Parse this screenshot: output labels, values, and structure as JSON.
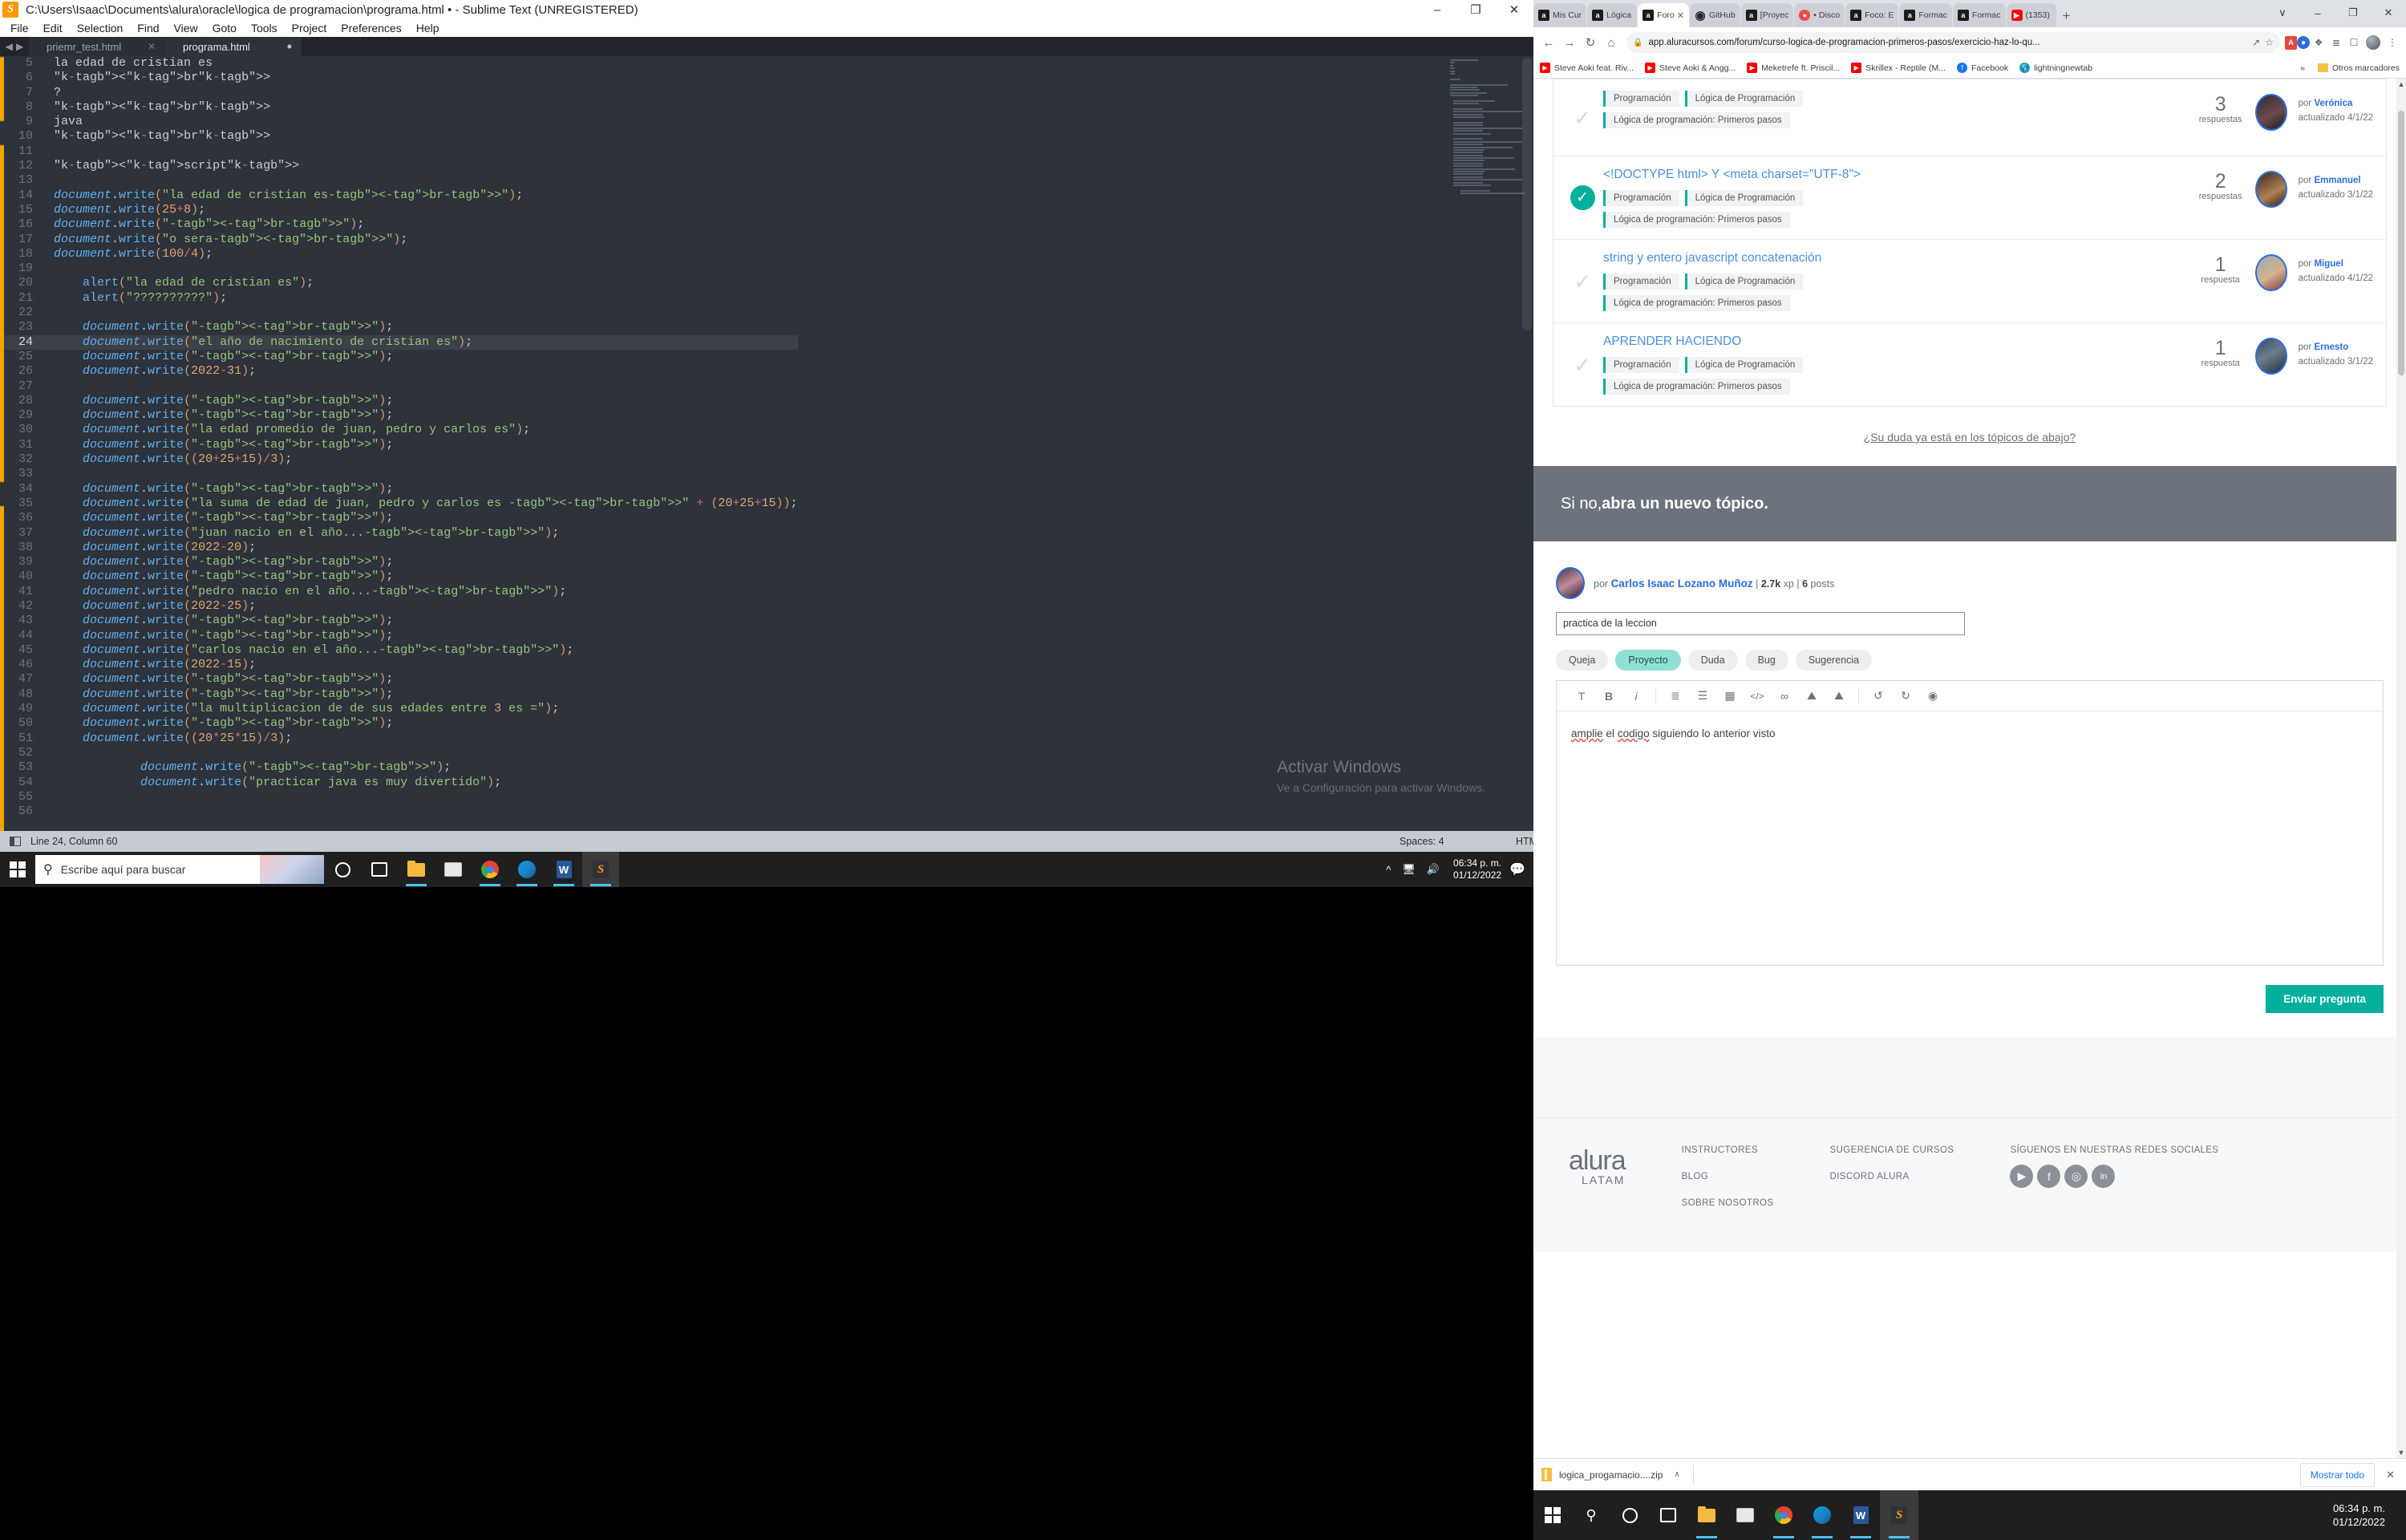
{
  "sublime": {
    "title": "C:\\Users\\Isaac\\Documents\\alura\\oracle\\logica de programacion\\programa.html • - Sublime Text (UNREGISTERED)",
    "menu": [
      "File",
      "Edit",
      "Selection",
      "Find",
      "View",
      "Goto",
      "Tools",
      "Project",
      "Preferences",
      "Help"
    ],
    "tabs": [
      {
        "label": "priemr_test.html",
        "active": false
      },
      {
        "label": "programa.html",
        "active": true
      }
    ],
    "window_buttons": {
      "minimize": "–",
      "maximize": "❐",
      "close": "✕"
    },
    "code_lines": [
      {
        "n": "5",
        "text": "la edad de cristian es"
      },
      {
        "n": "6",
        "text": "<br>"
      },
      {
        "n": "7",
        "text": "?"
      },
      {
        "n": "8",
        "text": "<br>"
      },
      {
        "n": "9",
        "text": "java"
      },
      {
        "n": "10",
        "text": "<br>"
      },
      {
        "n": "11",
        "text": ""
      },
      {
        "n": "12",
        "text": "<script>"
      },
      {
        "n": "13",
        "text": ""
      },
      {
        "n": "14",
        "text": "document.write(\"la edad de cristian es<br>\");"
      },
      {
        "n": "15",
        "text": "document.write(25+8);"
      },
      {
        "n": "16",
        "text": "document.write(\"<br>\");"
      },
      {
        "n": "17",
        "text": "document.write(\"o sera<br>\");"
      },
      {
        "n": "18",
        "text": "document.write(100/4);"
      },
      {
        "n": "19",
        "text": ""
      },
      {
        "n": "20",
        "text": "    alert(\"la edad de cristian es\");"
      },
      {
        "n": "21",
        "text": "    alert(\"??????????\");"
      },
      {
        "n": "22",
        "text": ""
      },
      {
        "n": "23",
        "text": "    document.write(\"<br>\");"
      },
      {
        "n": "24",
        "text": "    document.write(\"el año de nacimiento de cristian es\");"
      },
      {
        "n": "25",
        "text": "    document.write(\"<br>\");"
      },
      {
        "n": "26",
        "text": "    document.write(2022-31);"
      },
      {
        "n": "27",
        "text": ""
      },
      {
        "n": "28",
        "text": "    document.write(\"<br>\");"
      },
      {
        "n": "29",
        "text": "    document.write(\"<br>\");"
      },
      {
        "n": "30",
        "text": "    document.write(\"la edad promedio de juan, pedro y carlos es\");"
      },
      {
        "n": "31",
        "text": "    document.write(\"<br>\");"
      },
      {
        "n": "32",
        "text": "    document.write((20+25+15)/3);"
      },
      {
        "n": "33",
        "text": ""
      },
      {
        "n": "34",
        "text": "    document.write(\"<br>\");"
      },
      {
        "n": "35",
        "text": "    document.write(\"la suma de edad de juan, pedro y carlos es <br>\" + (20+25+15));"
      },
      {
        "n": "36",
        "text": "    document.write(\"<br>\");"
      },
      {
        "n": "37",
        "text": "    document.write(\"juan nacio en el año...<br>\");"
      },
      {
        "n": "38",
        "text": "    document.write(2022-20);"
      },
      {
        "n": "39",
        "text": "    document.write(\"<br>\");"
      },
      {
        "n": "40",
        "text": "    document.write(\"<br>\");"
      },
      {
        "n": "41",
        "text": "    document.write(\"pedro nacio en el año...<br>\");"
      },
      {
        "n": "42",
        "text": "    document.write(2022-25);"
      },
      {
        "n": "43",
        "text": "    document.write(\"<br>\");"
      },
      {
        "n": "44",
        "text": "    document.write(\"<br>\");"
      },
      {
        "n": "45",
        "text": "    document.write(\"carlos nacio en el año...<br>\");"
      },
      {
        "n": "46",
        "text": "    document.write(2022-15);"
      },
      {
        "n": "47",
        "text": "    document.write(\"<br>\");"
      },
      {
        "n": "48",
        "text": "    document.write(\"<br>\");"
      },
      {
        "n": "49",
        "text": "    document.write(\"la multiplicacion de de sus edades entre 3 es =\");"
      },
      {
        "n": "50",
        "text": "    document.write(\"<br>\");"
      },
      {
        "n": "51",
        "text": "    document.write((20*25*15)/3);"
      },
      {
        "n": "52",
        "text": ""
      },
      {
        "n": "53",
        "text": "            document.write(\"<br>\");"
      },
      {
        "n": "54",
        "text": "            document.write(\"practicar java es muy divertido\");"
      },
      {
        "n": "55",
        "text": ""
      },
      {
        "n": "56",
        "text": ""
      }
    ],
    "highlight_line": "24",
    "status": {
      "position": "Line 24, Column 60",
      "spaces": "Spaces: 4",
      "syntax": "HTML"
    },
    "watermark": {
      "title": "Activar Windows",
      "subtitle": "Ve a Configuración para activar Windows."
    }
  },
  "taskbar": {
    "search_placeholder": "Escribe aquí para buscar",
    "clock_time": "06:34 p. m.",
    "clock_date": "01/12/2022",
    "icons": [
      "cortana-icon",
      "task-view-icon",
      "file-explorer-icon",
      "mail-icon",
      "chrome-icon",
      "edge-icon",
      "word-icon",
      "sublime-icon"
    ]
  },
  "chrome": {
    "tabs": [
      {
        "label": "Mis Cur",
        "favicon": "alura-icon",
        "active": false
      },
      {
        "label": "Lógica",
        "favicon": "alura-icon",
        "active": false
      },
      {
        "label": "Foro",
        "favicon": "alura-icon",
        "active": true
      },
      {
        "label": "GitHub",
        "favicon": "github-icon",
        "active": false
      },
      {
        "label": "[Proyec",
        "favicon": "alura-icon",
        "active": false
      },
      {
        "label": "• Disco",
        "favicon": "discord-icon",
        "active": false
      },
      {
        "label": "Foco: E",
        "favicon": "alura-icon",
        "active": false
      },
      {
        "label": "Formac",
        "favicon": "alura-icon",
        "active": false
      },
      {
        "label": "Formac",
        "favicon": "alura-icon",
        "active": false
      },
      {
        "label": "(1353)",
        "favicon": "youtube-icon",
        "active": false
      }
    ],
    "new_tab_label": "+",
    "window_buttons": {
      "expand": "∨",
      "minimize": "–",
      "maximize": "❐",
      "close": "✕"
    },
    "url": "app.aluracursos.com/forum/curso-logica-de-programacion-primeros-pasos/exercicio-haz-lo-qu...",
    "nav": {
      "back": "←",
      "forward": "→",
      "reload": "↻",
      "home": "⌂"
    },
    "bookmarks": [
      {
        "label": "Steve Aoki feat. Riv...",
        "icon": "youtube-icon"
      },
      {
        "label": "Steve Aoki & Angg...",
        "icon": "youtube-icon"
      },
      {
        "label": "Meketrefe ft. Priscil...",
        "icon": "youtube-icon"
      },
      {
        "label": "Skrillex - Reptile (M...",
        "icon": "youtube-icon"
      },
      {
        "label": "Facebook",
        "icon": "facebook-icon"
      },
      {
        "label": "lightningnewtab",
        "icon": "globe-icon"
      }
    ],
    "bookmarks_overflow": "»",
    "bookmarks_folder": "Otros marcadores"
  },
  "forum": {
    "topics": [
      {
        "title": "",
        "solved": false,
        "tags": [
          "Programación",
          "Lógica de Programación",
          "Lógica de programación: Primeros pasos"
        ],
        "replies_count": "3",
        "replies_label": "respuestas",
        "author_prefix": "por",
        "author": "Verónica",
        "updated": "actualizado 4/1/22"
      },
      {
        "title": "<!DOCTYPE html> Y <meta charset=\"UTF-8\">",
        "solved": true,
        "tags": [
          "Programación",
          "Lógica de Programación",
          "Lógica de programación: Primeros pasos"
        ],
        "replies_count": "2",
        "replies_label": "respuestas",
        "author_prefix": "por",
        "author": "Emmanuel",
        "updated": "actualizado 3/1/22"
      },
      {
        "title": "string y entero javascript concatenación",
        "solved": false,
        "tags": [
          "Programación",
          "Lógica de Programación",
          "Lógica de programación: Primeros pasos"
        ],
        "replies_count": "1",
        "replies_label": "respuesta",
        "author_prefix": "por",
        "author": "Miguel",
        "updated": "actualizado 4/1/22"
      },
      {
        "title": "APRENDER HACIENDO",
        "solved": false,
        "tags": [
          "Programación",
          "Lógica de Programación",
          "Lógica de programación: Primeros pasos"
        ],
        "replies_count": "1",
        "replies_label": "respuesta",
        "author_prefix": "por",
        "author": "Ernesto",
        "updated": "actualizado 3/1/22"
      }
    ],
    "ask_link": "¿Su duda ya está en los tópicos de abajo?",
    "banner_prefix": "Si no, ",
    "banner_bold": "abra un nuevo tópico.",
    "poster": {
      "prefix": "por",
      "name": "Carlos Isaac Lozano Muñoz",
      "xp": "2.7k",
      "xp_label": "xp",
      "posts_count": "6",
      "posts_label": "posts"
    },
    "title_input_value": "practica de la leccion",
    "categories": [
      {
        "label": "Queja",
        "selected": false
      },
      {
        "label": "Proyecto",
        "selected": true
      },
      {
        "label": "Duda",
        "selected": false
      },
      {
        "label": "Bug",
        "selected": false
      },
      {
        "label": "Sugerencia",
        "selected": false
      }
    ],
    "editor_tools": [
      "text-format-icon",
      "bold-icon",
      "italic-icon",
      "ordered-list-icon",
      "bullet-list-icon",
      "table-icon",
      "code-icon",
      "link-icon",
      "image-icon",
      "upload-image-icon",
      "undo-icon",
      "redo-icon",
      "preview-icon"
    ],
    "editor_tool_labels": [
      "T",
      "B",
      "i",
      "≣",
      "☰",
      "▦",
      "</>",
      "∞",
      "⛰",
      "⛰",
      "↺",
      "↻",
      "◉"
    ],
    "editor_body_text": "amplie el codigo siguiendo lo anterior visto",
    "editor_body_words": [
      "amplie",
      "el",
      "codigo",
      "siguiendo lo anterior visto"
    ],
    "send_button": "Enviar pregunta"
  },
  "footer": {
    "logo": "alura",
    "logo_sub": "LATAM",
    "col1": [
      "INSTRUCTORES",
      "BLOG",
      "SOBRE NOSOTROS"
    ],
    "col2": [
      "SUGERENCIA DE CURSOS",
      "DISCORD ALURA"
    ],
    "social_title": "SÍGUENOS EN NUESTRAS REDES SOCIALES",
    "socials": [
      "youtube-icon",
      "facebook-icon",
      "instagram-icon",
      "linkedin-icon"
    ],
    "social_glyphs": [
      "▶",
      "f",
      "◎",
      "in"
    ]
  },
  "download_bar": {
    "file_name": "logica_progamacio....zip",
    "caret": "∧",
    "show_all": "Mostrar todo",
    "close": "✕"
  },
  "colors": {
    "accent_teal": "#00b09c",
    "link_blue": "#4a90d9",
    "banner_gray": "#6c737c",
    "editor_bg": "#2d323b"
  }
}
